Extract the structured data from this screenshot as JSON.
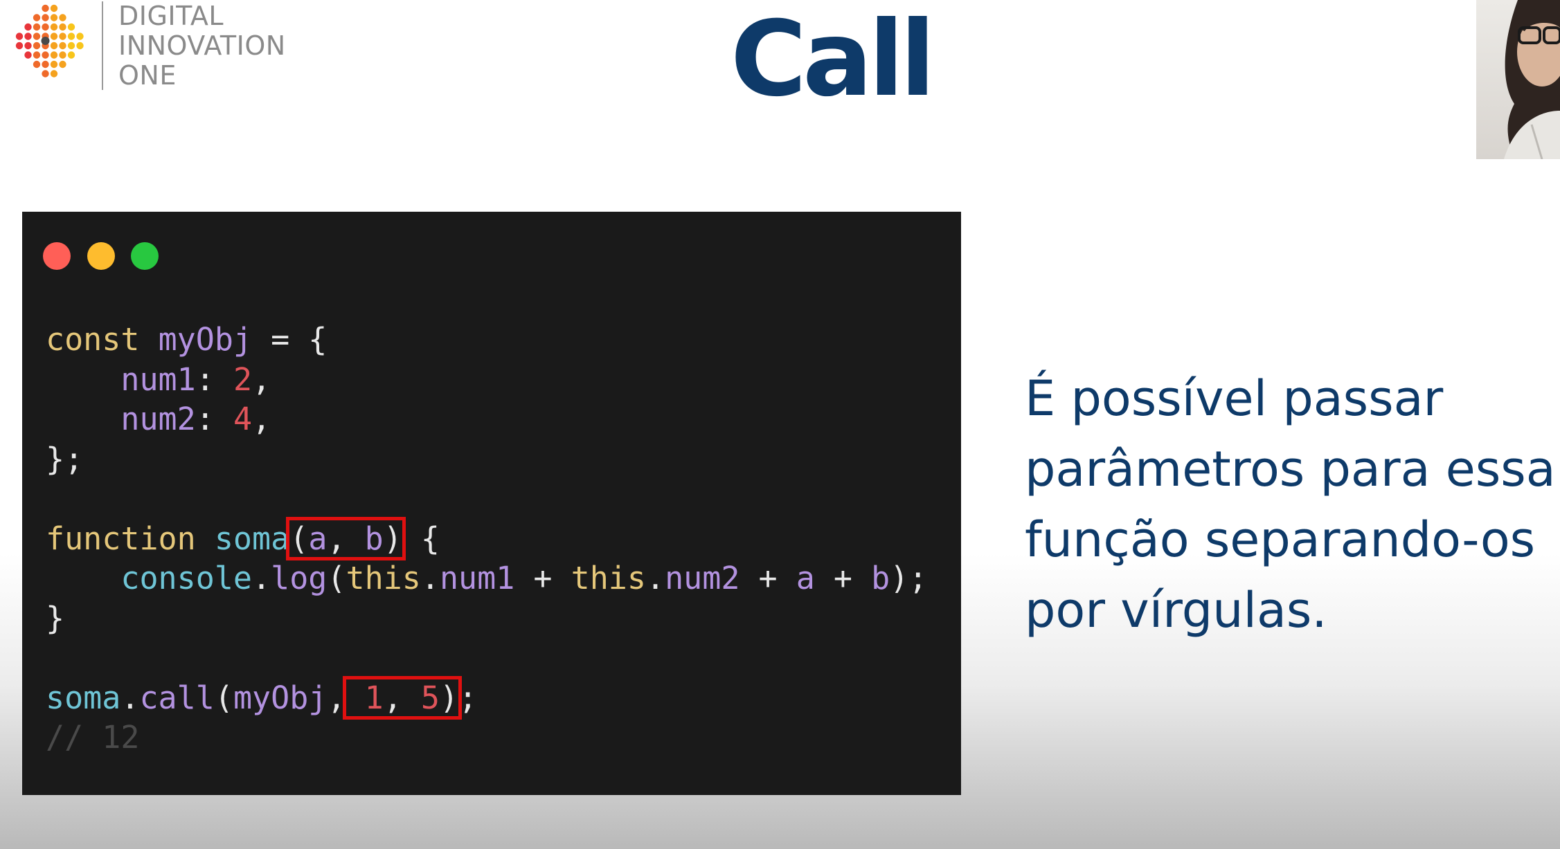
{
  "logo": {
    "line1": "DIGITAL",
    "line2": "INNOVATION",
    "line3": "ONE"
  },
  "title": "Call",
  "code_window": {
    "lines": [
      [
        {
          "t": "const ",
          "c": "kw"
        },
        {
          "t": "myObj ",
          "c": "id"
        },
        {
          "t": "= {",
          "c": "pun"
        }
      ],
      [
        {
          "t": "    num1",
          "c": "id"
        },
        {
          "t": ": ",
          "c": "pun"
        },
        {
          "t": "2",
          "c": "num"
        },
        {
          "t": ",",
          "c": "pun"
        }
      ],
      [
        {
          "t": "    num2",
          "c": "id"
        },
        {
          "t": ": ",
          "c": "pun"
        },
        {
          "t": "4",
          "c": "num"
        },
        {
          "t": ",",
          "c": "pun"
        }
      ],
      [
        {
          "t": "};",
          "c": "pun"
        }
      ],
      [],
      [
        {
          "t": "function ",
          "c": "kw"
        },
        {
          "t": "soma",
          "c": "fn"
        },
        {
          "t": "(",
          "c": "pun",
          "hl": "start"
        },
        {
          "t": "a",
          "c": "id",
          "hl": "in"
        },
        {
          "t": ", ",
          "c": "pun",
          "hl": "in"
        },
        {
          "t": "b",
          "c": "id",
          "hl": "in"
        },
        {
          "t": ")",
          "c": "pun",
          "hl": "end"
        },
        {
          "t": " {",
          "c": "pun"
        }
      ],
      [
        {
          "t": "    console",
          "c": "fn"
        },
        {
          "t": ".",
          "c": "pun"
        },
        {
          "t": "log",
          "c": "id"
        },
        {
          "t": "(",
          "c": "pun"
        },
        {
          "t": "this",
          "c": "kw"
        },
        {
          "t": ".",
          "c": "pun"
        },
        {
          "t": "num1",
          "c": "id"
        },
        {
          "t": " + ",
          "c": "pun"
        },
        {
          "t": "this",
          "c": "kw"
        },
        {
          "t": ".",
          "c": "pun"
        },
        {
          "t": "num2",
          "c": "id"
        },
        {
          "t": " + ",
          "c": "pun"
        },
        {
          "t": "a",
          "c": "id"
        },
        {
          "t": " + ",
          "c": "pun"
        },
        {
          "t": "b",
          "c": "id"
        },
        {
          "t": ");",
          "c": "pun"
        }
      ],
      [
        {
          "t": "}",
          "c": "pun"
        }
      ],
      [],
      [
        {
          "t": "soma",
          "c": "fn"
        },
        {
          "t": ".",
          "c": "pun"
        },
        {
          "t": "call",
          "c": "id"
        },
        {
          "t": "(",
          "c": "pun"
        },
        {
          "t": "myObj",
          "c": "id"
        },
        {
          "t": ",",
          "c": "pun"
        },
        {
          "t": " 1",
          "c": "num",
          "hl": "start"
        },
        {
          "t": ", ",
          "c": "pun",
          "hl": "in"
        },
        {
          "t": "5",
          "c": "num",
          "hl": "in"
        },
        {
          "t": ")",
          "c": "pun",
          "hl": "end"
        },
        {
          "t": ";",
          "c": "pun"
        }
      ],
      [
        {
          "t": "// 12",
          "c": "cmt"
        }
      ]
    ]
  },
  "explanation": {
    "line1": "É possível passar",
    "line2": "parâmetros para essa",
    "line3": "função separando-os",
    "line4": "por vírgulas."
  },
  "colors": {
    "title": "#0e3a69",
    "highlight_box": "#e01010",
    "window_bg": "#1a1a1a"
  },
  "icons": [
    "logo-dots-icon",
    "close-dot-icon",
    "minimize-dot-icon",
    "maximize-dot-icon"
  ]
}
